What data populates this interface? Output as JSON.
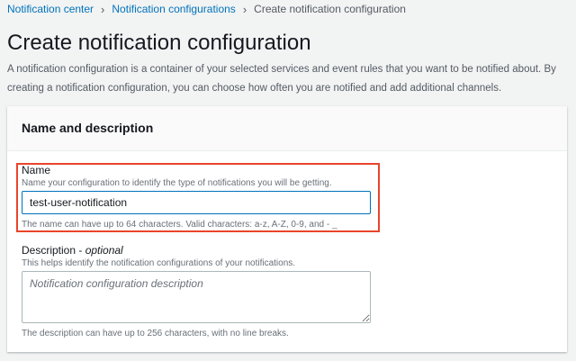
{
  "breadcrumb": {
    "items": [
      "Notification center",
      "Notification configurations"
    ],
    "current": "Create notification configuration"
  },
  "page": {
    "title": "Create notification configuration",
    "description": "A notification configuration is a container of your selected services and event rules that you want to be notified about. By creating a notification configuration, you can choose how often you are notified and add additional channels."
  },
  "card": {
    "title": "Name and description"
  },
  "name_field": {
    "label": "Name",
    "help": "Name your configuration to identify the type of notifications you will be getting.",
    "value": "test-user-notification",
    "constraint": "The name can have up to 64 characters. Valid characters: a-z, A-Z, 0-9, and - _"
  },
  "description_field": {
    "label": "Description - ",
    "optional": "optional",
    "help": "This helps identify the notification configurations of your notifications.",
    "placeholder": "Notification configuration description",
    "constraint": "The description can have up to 256 characters, with no line breaks."
  },
  "colors": {
    "highlight": "#e8452c",
    "link": "#0073bb"
  }
}
